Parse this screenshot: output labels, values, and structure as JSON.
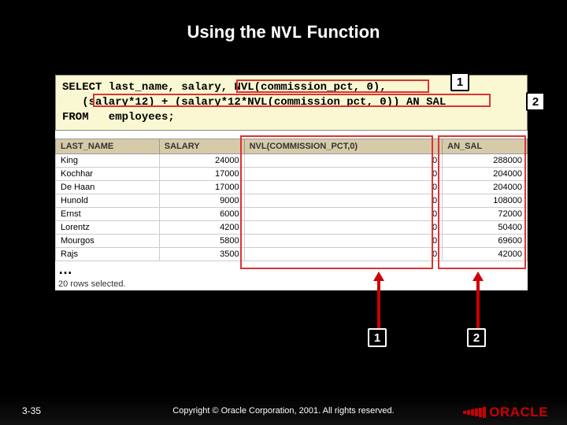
{
  "title_pre": "Using the ",
  "title_mono": "NVL",
  "title_post": " Function",
  "sql": "SELECT last_name, salary, NVL(commission_pct, 0),\n   (salary*12) + (salary*12*NVL(commission_pct, 0)) AN_SAL\nFROM   employees;",
  "columns": [
    "LAST_NAME",
    "SALARY",
    "NVL(COMMISSION_PCT,0)",
    "AN_SAL"
  ],
  "rows": [
    {
      "name": "King",
      "salary": "24000",
      "nvl": "0",
      "ansal": "288000"
    },
    {
      "name": "Kochhar",
      "salary": "17000",
      "nvl": "0",
      "ansal": "204000"
    },
    {
      "name": "De Haan",
      "salary": "17000",
      "nvl": "0",
      "ansal": "204000"
    },
    {
      "name": "Hunold",
      "salary": "9000",
      "nvl": "0",
      "ansal": "108000"
    },
    {
      "name": "Ernst",
      "salary": "6000",
      "nvl": "0",
      "ansal": "72000"
    },
    {
      "name": "Lorentz",
      "salary": "4200",
      "nvl": "0",
      "ansal": "50400"
    },
    {
      "name": "Mourgos",
      "salary": "5800",
      "nvl": "0",
      "ansal": "69600"
    },
    {
      "name": "Rajs",
      "salary": "3500",
      "nvl": "0",
      "ansal": "42000"
    }
  ],
  "ellipsis": "…",
  "rowcount": "20 rows selected.",
  "badges": {
    "b1": "1",
    "b2": "2"
  },
  "footer": {
    "page": "3-35",
    "copyright": "Copyright © Oracle Corporation, 2001. All rights reserved.",
    "logo": "ORACLE"
  }
}
